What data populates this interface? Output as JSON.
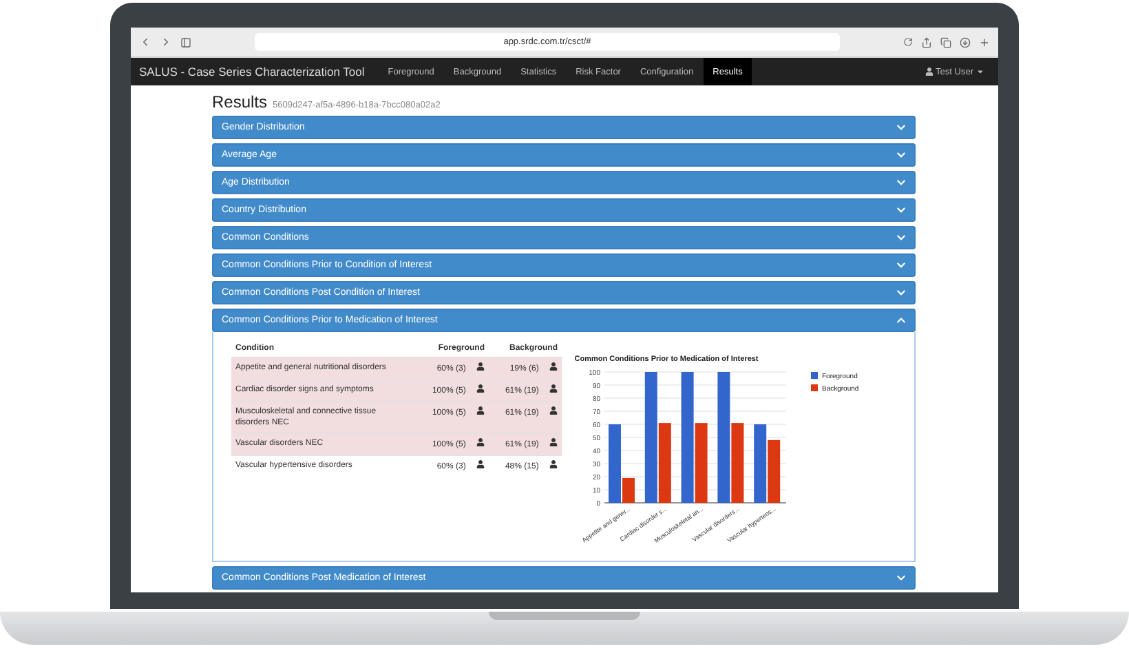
{
  "browser": {
    "url": "app.srdc.com.tr/csct/#"
  },
  "navbar": {
    "brand": "SALUS - Case Series Characterization Tool",
    "items": [
      {
        "label": "Foreground",
        "selected": false
      },
      {
        "label": "Background",
        "selected": false
      },
      {
        "label": "Statistics",
        "selected": false
      },
      {
        "label": "Risk Factor",
        "selected": false
      },
      {
        "label": "Configuration",
        "selected": false
      },
      {
        "label": "Results",
        "selected": true
      }
    ],
    "user": "Test User"
  },
  "page": {
    "title": "Results",
    "id": "5609d247-af5a-4896-b18a-7bcc080a02a2"
  },
  "sections": [
    {
      "title": "Gender Distribution",
      "expanded": false
    },
    {
      "title": "Average Age",
      "expanded": false
    },
    {
      "title": "Age Distribution",
      "expanded": false
    },
    {
      "title": "Country Distribution",
      "expanded": false
    },
    {
      "title": "Common Conditions",
      "expanded": false
    },
    {
      "title": "Common Conditions Prior to Condition of Interest",
      "expanded": false
    },
    {
      "title": "Common Conditions Post Condition of Interest",
      "expanded": false
    },
    {
      "title": "Common Conditions Prior to Medication of Interest",
      "expanded": true,
      "table": {
        "columns": [
          "Condition",
          "Foreground",
          "Background"
        ],
        "rows": [
          {
            "condition": "Appetite and general nutritional disorders",
            "foreground": "60% (3)",
            "background": "19% (6)",
            "highlighted": true
          },
          {
            "condition": "Cardiac disorder signs and symptoms",
            "foreground": "100% (5)",
            "background": "61% (19)",
            "highlighted": true
          },
          {
            "condition": "Musculoskeletal and connective tissue disorders NEC",
            "foreground": "100% (5)",
            "background": "61% (19)",
            "highlighted": true
          },
          {
            "condition": "Vascular disorders NEC",
            "foreground": "100% (5)",
            "background": "61% (19)",
            "highlighted": true
          },
          {
            "condition": "Vascular hypertensive disorders",
            "foreground": "60% (3)",
            "background": "48% (15)",
            "highlighted": false
          }
        ]
      },
      "chart_data": {
        "type": "bar",
        "title": "Common Conditions Prior to Medication of Interest",
        "categories": [
          "Appetite and gener...",
          "Cardiac disorder s...",
          "Musculoskeletal an...",
          "Vascular disorders...",
          "Vascular hypertens..."
        ],
        "series": [
          {
            "name": "Foreground",
            "color": "#3366cc",
            "values": [
              60,
              100,
              100,
              100,
              60
            ]
          },
          {
            "name": "Background",
            "color": "#dc3912",
            "values": [
              19,
              61,
              61,
              61,
              48
            ]
          }
        ],
        "grid": true,
        "legend": true,
        "ylim": [
          0,
          100
        ],
        "yticks": [
          0,
          10,
          20,
          30,
          40,
          50,
          60,
          70,
          80,
          90,
          100
        ]
      }
    },
    {
      "title": "Common Conditions Post Medication of Interest",
      "expanded": false
    }
  ]
}
